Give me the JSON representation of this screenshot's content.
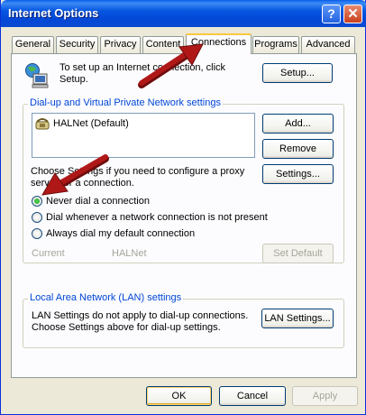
{
  "window": {
    "title": "Internet Options"
  },
  "titlebar": {
    "help": "?",
    "close": "✕"
  },
  "tabs": [
    {
      "label": "General"
    },
    {
      "label": "Security"
    },
    {
      "label": "Privacy"
    },
    {
      "label": "Content"
    },
    {
      "label": "Connections"
    },
    {
      "label": "Programs"
    },
    {
      "label": "Advanced"
    }
  ],
  "active_tab": "Connections",
  "setup": {
    "text_line1": "To set up an Internet connection, click",
    "text_line2": "Setup.",
    "button": "Setup..."
  },
  "dialup": {
    "group_label": "Dial-up and Virtual Private Network settings",
    "items": [
      {
        "label": "HALNet (Default)"
      }
    ],
    "add": "Add...",
    "remove": "Remove",
    "settings": "Settings...",
    "choose_line1": "Choose Settings if you need to configure a proxy",
    "choose_line2": "server for a connection.",
    "options": [
      {
        "label": "Never dial a connection",
        "selected": true
      },
      {
        "label": "Dial whenever a network connection is not present",
        "selected": false
      },
      {
        "label": "Always dial my default connection",
        "selected": false
      }
    ],
    "current_label": "Current",
    "current_value": "HALNet",
    "set_default": "Set Default"
  },
  "lan": {
    "group_label": "Local Area Network (LAN) settings",
    "text_line1": "LAN Settings do not apply to dial-up connections.",
    "text_line2": "Choose Settings above for dial-up settings.",
    "button": "LAN Settings..."
  },
  "footer": {
    "ok": "OK",
    "cancel": "Cancel",
    "apply": "Apply"
  },
  "colors": {
    "title_blue": "#0756e0",
    "group_label": "#0046d5",
    "annotation_arrow": "#b01818",
    "selected_radio": "#21a121"
  }
}
